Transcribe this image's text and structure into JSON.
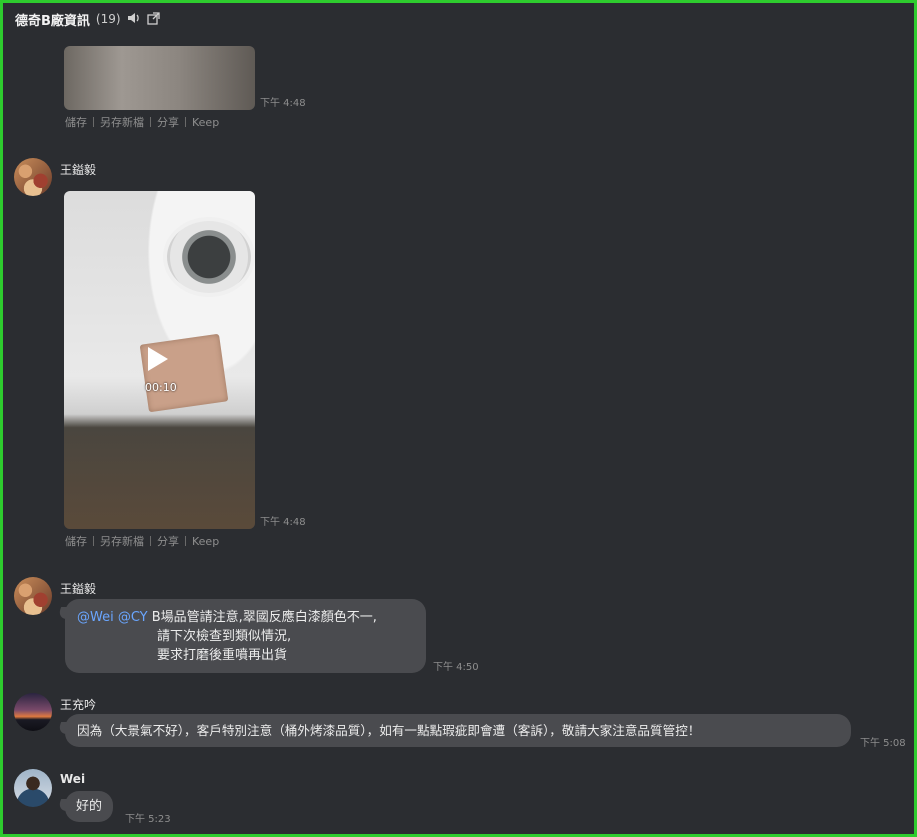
{
  "header": {
    "title": "德奇B廠資訊",
    "count": "(19)",
    "icons": [
      "speaker-icon",
      "popout-icon"
    ]
  },
  "colors": {
    "frame": "#2ecc2e",
    "background": "#2b2d31",
    "bubble": "#4a4b4f",
    "mention": "#6aa6ff"
  },
  "messages": [
    {
      "type": "image",
      "time": "下午 4:48",
      "actions": [
        "儲存",
        "另存新檔",
        "分享",
        "Keep"
      ]
    },
    {
      "type": "video",
      "sender": "王鎰毅",
      "duration": "00:10",
      "time": "下午 4:48",
      "actions": [
        "儲存",
        "另存新檔",
        "分享",
        "Keep"
      ]
    },
    {
      "type": "text",
      "sender": "王鎰毅",
      "mentions": "@Wei @CY",
      "line1": " B場品管請注意,翠國反應白漆顏色不一,",
      "line2": "請下次檢查到類似情況,",
      "line3": "要求打磨後重噴再出貨",
      "time": "下午 4:50"
    },
    {
      "type": "text",
      "sender": "王充吟",
      "text": "因為（大景氣不好），客戶特別注意（桶外烤漆品質），如有一點點瑕疵即會遭（客訴），敬請大家注意品質管控！",
      "time": "下午 5:08"
    },
    {
      "type": "text",
      "sender": "Wei",
      "text": "好的",
      "time": "下午 5:23"
    }
  ]
}
